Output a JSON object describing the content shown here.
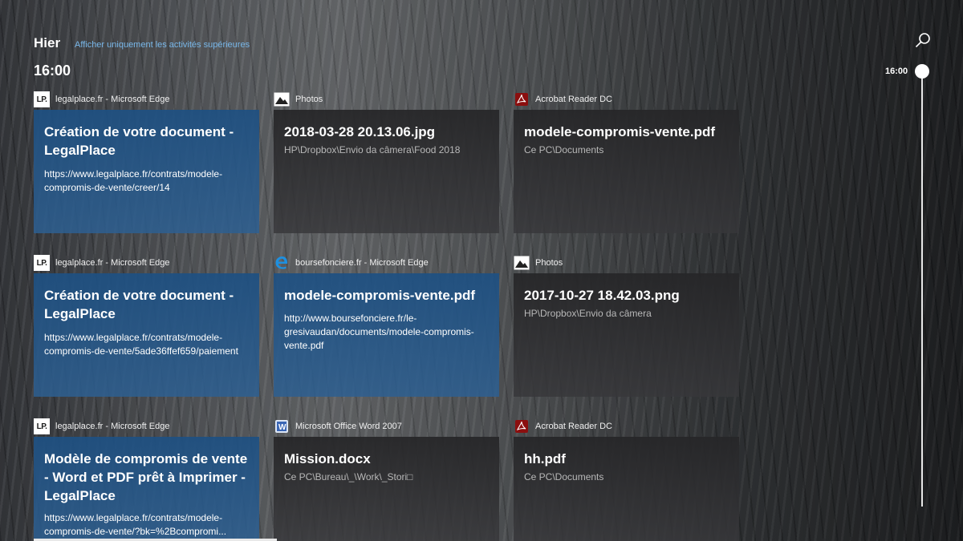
{
  "header": {
    "day": "Hier",
    "filter_link": "Afficher uniquement les activités supérieures",
    "time": "16:00"
  },
  "timeline": {
    "label": "16:00"
  },
  "icons": {
    "search": "search-icon"
  },
  "colors": {
    "accent_link": "#79b8ea",
    "edge_tile": "#1e5082",
    "dark_tile": "#262628"
  },
  "rows": [
    {
      "tiles": [
        {
          "app": "legalplace.fr - Microsoft Edge",
          "icon": "LP.",
          "title": "Création de votre document - LegalPlace",
          "sub": "https://www.legalplace.fr/contrats/modele-compromis-de-vente/creer/14"
        },
        {
          "app": "Photos",
          "title": "2018-03-28 20.13.06.jpg",
          "sub": "HP\\Dropbox\\Envio da câmera\\Food 2018"
        },
        {
          "app": "Acrobat Reader DC",
          "title": "modele-compromis-vente.pdf",
          "sub": "Ce PC\\Documents"
        }
      ]
    },
    {
      "tiles": [
        {
          "app": "legalplace.fr - Microsoft Edge",
          "icon": "LP.",
          "title": "Création de votre document - LegalPlace",
          "sub": "https://www.legalplace.fr/contrats/modele-compromis-de-vente/5ade36ffef659/paiement"
        },
        {
          "app": "boursefonciere.fr - Microsoft Edge",
          "title": "modele-compromis-vente.pdf",
          "sub": "http://www.boursefonciere.fr/le-gresivaudan/documents/modele-compromis-vente.pdf"
        },
        {
          "app": "Photos",
          "title": "2017-10-27 18.42.03.png",
          "sub": "HP\\Dropbox\\Envio da câmera"
        }
      ]
    },
    {
      "tiles": [
        {
          "app": "legalplace.fr - Microsoft Edge",
          "icon": "LP.",
          "title": "Modèle de compromis de vente - Word et PDF prêt à Imprimer - LegalPlace",
          "sub": "https://www.legalplace.fr/contrats/modele-compromis-de-vente/?bk=%2Bcompromi..."
        },
        {
          "app": "Microsoft Office Word 2007",
          "title": "Mission.docx",
          "sub": "Ce PC\\Bureau\\_\\Work\\_Stori□"
        },
        {
          "app": "Acrobat Reader DC",
          "title": "hh.pdf",
          "sub": "Ce PC\\Documents"
        }
      ]
    }
  ]
}
